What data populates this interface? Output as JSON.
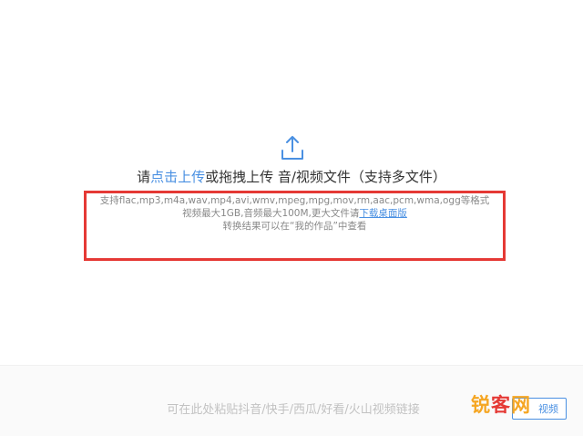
{
  "upload": {
    "icon": "upload-icon",
    "prefix": "请",
    "click_upload": "点击上传",
    "suffix": "或拖拽上传 音/视频文件（支持多文件）"
  },
  "info": {
    "formats": "支持flac,mp3,m4a,wav,mp4,avi,wmv,mpeg,mpg,mov,rm,aac,pcm,wma,ogg等格式",
    "size_limit": "视频最大1GB,音频最大100M,更大文件请",
    "download_desktop": "下载桌面版",
    "result_hint": "转换结果可以在“我的作品”中查看"
  },
  "paste": {
    "placeholder": "可在此处粘贴抖音/快手/西瓜/好看/火山视频链接",
    "button_label": "视频"
  },
  "watermark": {
    "part1": "锐",
    "part2": "客",
    "part3": "网"
  },
  "colors": {
    "link": "#4a90e2",
    "highlight_box": "#e53935",
    "watermark_orange": "#f5a623",
    "watermark_red": "#e53935"
  }
}
